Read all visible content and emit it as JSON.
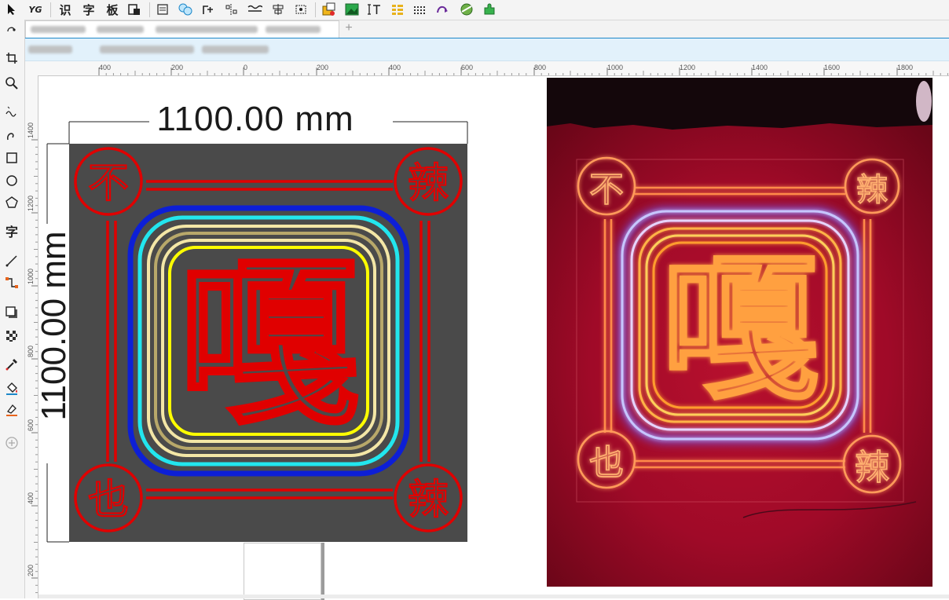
{
  "toolbar": {
    "btn_recognize": "识",
    "btn_char": "字",
    "btn_board": "板",
    "btn_yg": "YG"
  },
  "toolbox": {
    "text_tool": "字"
  },
  "ruler": {
    "h_ticks": [
      "400",
      "200",
      "0",
      "200",
      "400",
      "600",
      "800",
      "1000",
      "1200",
      "1400",
      "1600",
      "1800"
    ],
    "v_ticks": [
      "1400",
      "1200",
      "1000",
      "800",
      "600",
      "400",
      "200"
    ]
  },
  "canvas": {
    "dim_width": "1100.00 mm",
    "dim_height": "1100.00 mm",
    "design": {
      "main_char": "嘎",
      "corner_tl": "不",
      "corner_tr": "辣",
      "corner_bl": "也",
      "corner_br": "辣"
    },
    "photo": {
      "main_char": "嘎",
      "corner_tl": "不",
      "corner_tr": "辣",
      "corner_bl": "也",
      "corner_br": "辣"
    }
  },
  "colors": {
    "neon_red": "#e00000",
    "outline_blue": "#0d1fd6",
    "outline_cyan": "#22e6ee",
    "outline_cream": "#f3e6a6",
    "outline_tan": "#b8a86a",
    "outline_yellow": "#ffff00",
    "board_gray": "#4a4a4a",
    "accent_blue": "#1e88c9"
  }
}
